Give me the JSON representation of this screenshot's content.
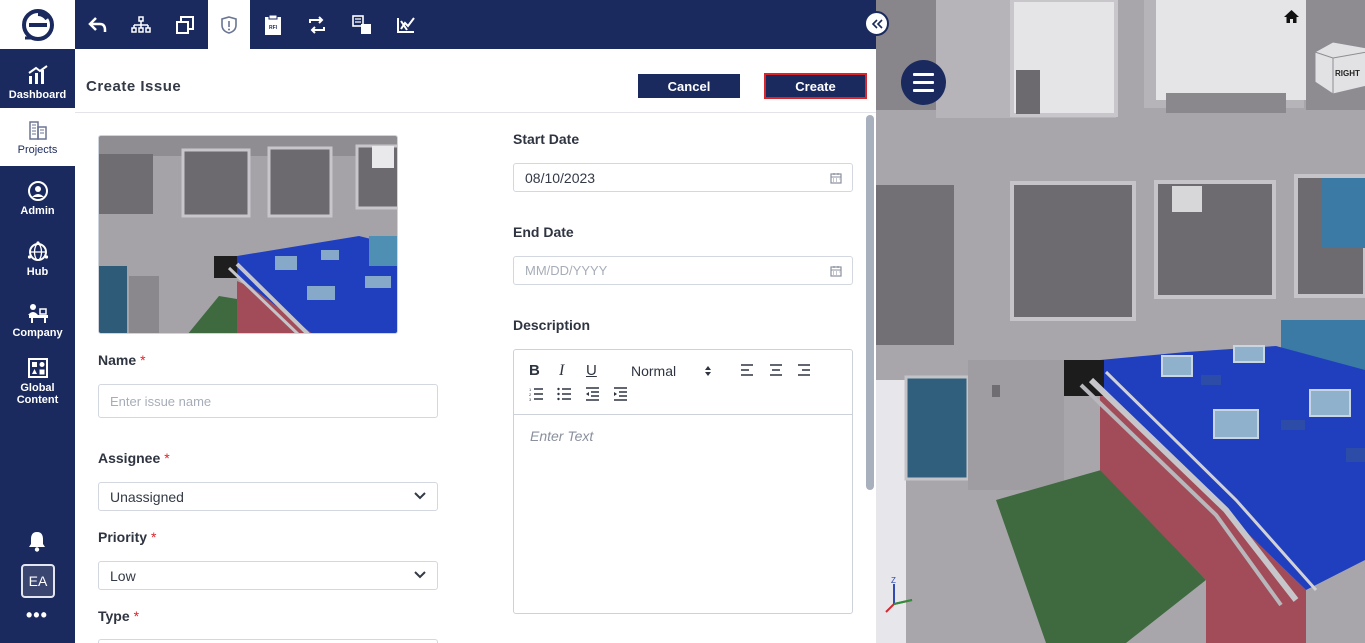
{
  "sidebar": {
    "items": [
      {
        "label": "Dashboard",
        "icon": "dashboard-chart-icon"
      },
      {
        "label": "Projects",
        "icon": "building-icon"
      },
      {
        "label": "Admin",
        "icon": "admin-user-icon"
      },
      {
        "label": "Hub",
        "icon": "hub-globe-icon"
      },
      {
        "label": "Company",
        "icon": "company-icon"
      },
      {
        "label": "Global Content",
        "icon": "global-content-icon"
      }
    ],
    "avatar_initials": "EA",
    "more": "•••"
  },
  "toolbar": {
    "icons": [
      "back-arrow-icon",
      "hierarchy-icon",
      "copy-windows-icon",
      "issue-shield-icon",
      "rfi-clipboard-icon",
      "sync-icon",
      "compare-icon",
      "markup-icon"
    ],
    "active": "issue-shield-icon"
  },
  "form": {
    "title": "Create Issue",
    "cancel_label": "Cancel",
    "create_label": "Create",
    "name": {
      "label": "Name",
      "required": "*",
      "placeholder": "Enter issue name"
    },
    "assignee": {
      "label": "Assignee",
      "required": "*",
      "value": "Unassigned"
    },
    "priority": {
      "label": "Priority",
      "required": "*",
      "value": "Low"
    },
    "type": {
      "label": "Type",
      "required": "*"
    },
    "start_date": {
      "label": "Start Date",
      "value": "08/10/2023"
    },
    "end_date": {
      "label": "End Date",
      "placeholder": "MM/DD/YYYY"
    },
    "description": {
      "label": "Description",
      "placeholder": "Enter Text",
      "toolbar": {
        "bold": "B",
        "italic": "I",
        "underline": "U",
        "style": "Normal"
      }
    }
  },
  "viewer": {
    "cube_label": "RIGHT",
    "axis_z": "Z",
    "colors": {
      "accent": "#1b2a5e",
      "create_border": "#d9262d",
      "floor_blue": "#1f3fbf",
      "wall_red": "#9b4a55"
    }
  }
}
